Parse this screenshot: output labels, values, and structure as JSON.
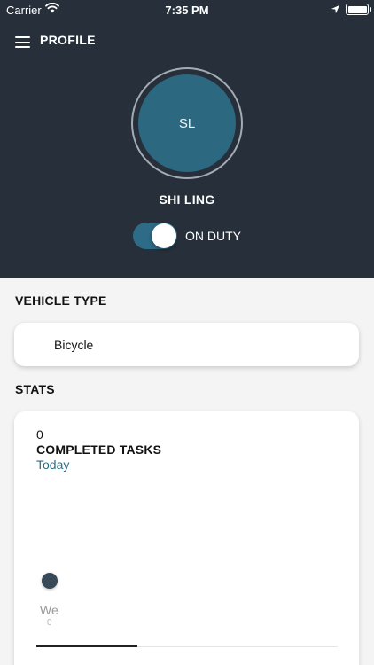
{
  "status_bar": {
    "carrier": "Carrier",
    "time": "7:35 PM"
  },
  "header": {
    "title": "PROFILE",
    "menu_icon": "hamburger-menu-icon",
    "background_color": "#27303a"
  },
  "profile": {
    "initials": "SL",
    "name": "SHI LING",
    "avatar_color": "#2c6880",
    "duty_toggle": {
      "on": true,
      "label": "ON DUTY"
    }
  },
  "vehicle": {
    "heading": "VEHICLE TYPE",
    "value": "Bicycle"
  },
  "stats": {
    "heading": "STATS",
    "count": "0",
    "label": "COMPLETED TASKS",
    "period": "Today",
    "accent_color": "#2d6d88",
    "chart_data": {
      "type": "line",
      "categories": [
        "We"
      ],
      "series": [
        {
          "values": [
            0
          ]
        }
      ],
      "value_labels": [
        "0"
      ]
    }
  }
}
